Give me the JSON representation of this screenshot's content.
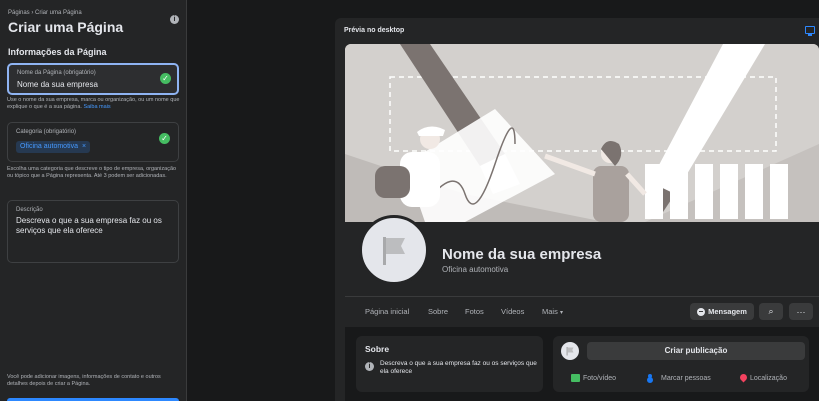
{
  "sidebar": {
    "breadcrumb": "Páginas › Criar uma Página",
    "title": "Criar uma Página",
    "section_title": "Informações da Página",
    "name_field": {
      "label": "Nome da Página (obrigatório)",
      "value": "Nome da sua empresa",
      "help": "Use o nome da sua empresa, marca ou organização, ou um nome que explique o que é a sua página.",
      "help_link": "Saiba mais"
    },
    "category_field": {
      "label": "Categoria (obrigatório)",
      "chip": "Oficina automotiva",
      "chip_remove": "×",
      "help": "Escolha uma categoria que descreve o tipo de empresa, organização ou tópico que a Página representa. Até 3 podem ser adicionadas."
    },
    "description_field": {
      "label": "Descrição",
      "placeholder": "Descreva o que a sua empresa faz ou os serviços que ela oferece"
    },
    "footer_note": "Você pode adicionar imagens, informações de contato e outros detalhes depois de criar a Página."
  },
  "preview": {
    "title": "Prévia no desktop",
    "page_name": "Nome da sua empresa",
    "page_category": "Oficina automotiva",
    "tabs": [
      "Página inicial",
      "Sobre",
      "Fotos",
      "Vídeos",
      "Mais"
    ],
    "tab_more_caret": "▾",
    "message_button": "Mensagem",
    "search_glyph": "⌕",
    "more_glyph": "···",
    "about": {
      "title": "Sobre",
      "text": "Descreva o que a sua empresa faz ou os serviços que ela oferece"
    },
    "post": {
      "create_button": "Criar publicação",
      "actions": [
        "Foto/vídeo",
        "Marcar pessoas",
        "Localização"
      ]
    }
  },
  "colors": {
    "background": "#18191a",
    "panel": "#242526",
    "accent": "#2d88ff",
    "success": "#45bd62"
  }
}
